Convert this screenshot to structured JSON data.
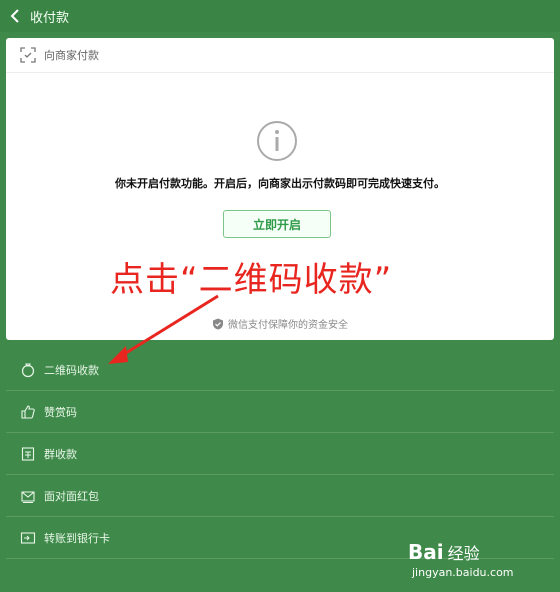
{
  "header": {
    "title": "收付款"
  },
  "card": {
    "section_title": "向商家付款",
    "notice": "你未开启付款功能。开启后，向商家出示付款码即可完成快速支付。",
    "enable_button": "立即开启",
    "security_text": "微信支付保障你的资金安全"
  },
  "annotation": {
    "text": "点击“二维码收款”",
    "color": "#e8261f"
  },
  "menu": {
    "items": [
      {
        "label": "二维码收款",
        "icon": "money-bag-icon"
      },
      {
        "label": "赞赏码",
        "icon": "thumb-icon"
      },
      {
        "label": "群收款",
        "icon": "group-receipt-icon"
      },
      {
        "label": "面对面红包",
        "icon": "red-packet-icon"
      },
      {
        "label": "转账到银行卡",
        "icon": "bank-card-icon"
      }
    ]
  },
  "watermark": {
    "brand": "Bai",
    "brand_suffix": "经验",
    "url": "jingyan.baidu.com"
  },
  "colors": {
    "background": "#3f8a4a",
    "accent": "#2f9a48"
  }
}
